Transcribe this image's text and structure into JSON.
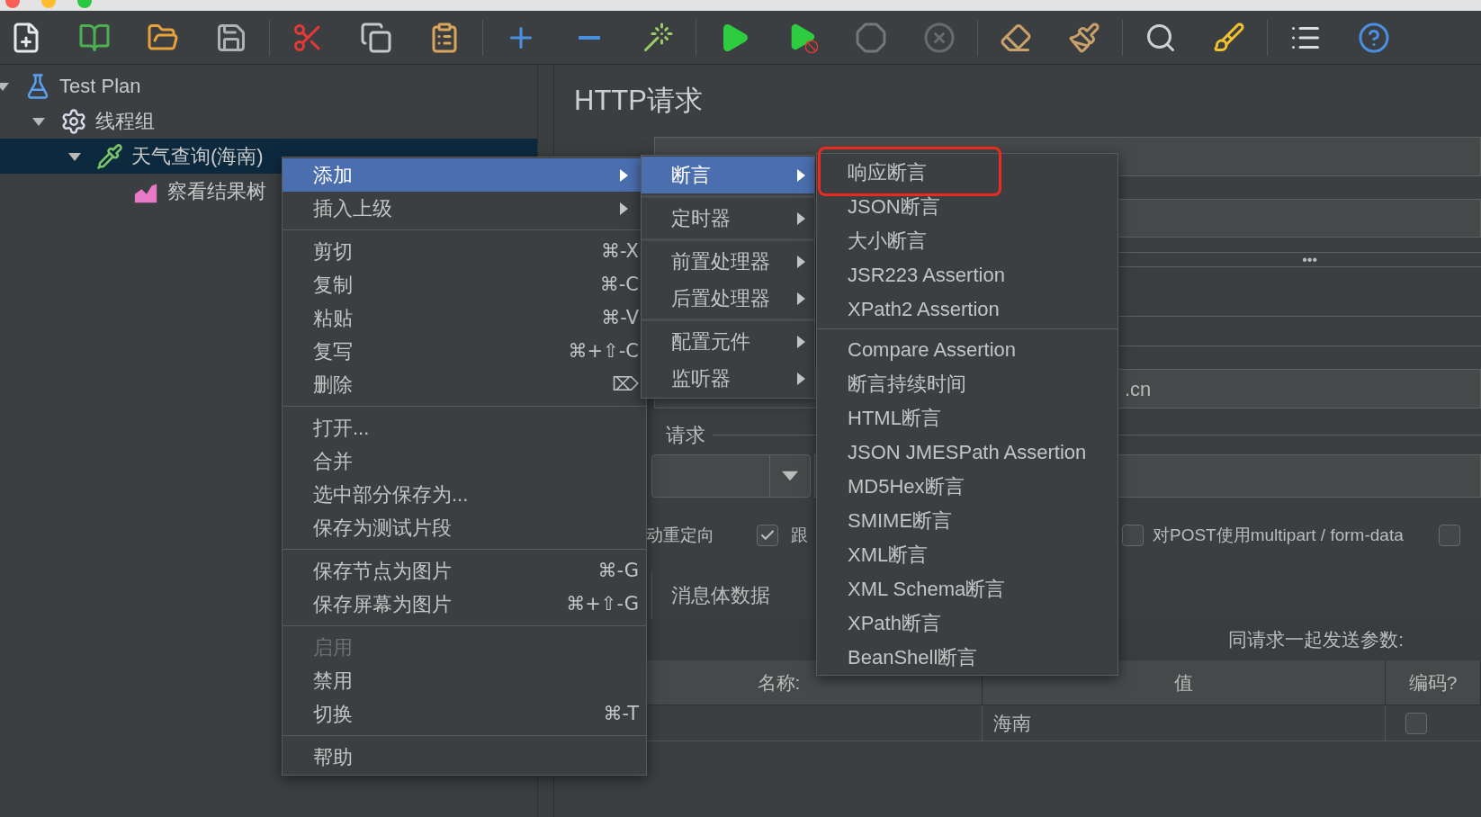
{
  "tree": [
    {
      "label": "Test Plan",
      "kind": "plan",
      "expanded": true,
      "selected": false,
      "children": [
        {
          "label": "线程组",
          "kind": "thread_group",
          "expanded": true,
          "selected": false,
          "children": [
            {
              "label": "天气查询(海南)",
              "kind": "sampler",
              "expanded": true,
              "selected": true,
              "children": [
                {
                  "label": "察看结果树",
                  "kind": "listener",
                  "selected": false
                }
              ]
            }
          ]
        }
      ]
    }
  ],
  "editor": {
    "title": "HTTP请求",
    "more_button": "•••",
    "server_value": ".cn",
    "group_label": "请求",
    "redirect_label": "动重定向",
    "checkboxes": [
      {
        "label": "跟",
        "checked": true
      },
      {
        "label": "对POST使用multipart / form-data",
        "checked": false
      },
      {
        "checked": false
      }
    ],
    "tabs": [
      {
        "label": "消息体数据",
        "selected": false
      }
    ],
    "params_caption": "同请求一起发送参数:",
    "columns": [
      "名称:",
      "值",
      "编码?"
    ],
    "rows": [
      {
        "value": "海南",
        "encode": false
      }
    ]
  },
  "context_menu": {
    "sections": [
      {
        "items": [
          {
            "label": "添加",
            "submenu": true,
            "selected": true,
            "disabled": false
          },
          {
            "label": "插入上级",
            "submenu": true,
            "selected": false,
            "disabled": false
          }
        ]
      },
      {
        "items": [
          {
            "label": "剪切",
            "shortcut": "⌘-X",
            "submenu": false,
            "selected": false,
            "disabled": false
          },
          {
            "label": "复制",
            "shortcut": "⌘-C",
            "submenu": false,
            "selected": false,
            "disabled": false
          },
          {
            "label": "粘贴",
            "shortcut": "⌘-V",
            "submenu": false,
            "selected": false,
            "disabled": false
          },
          {
            "label": "复写",
            "shortcut": "⌘+⇧-C",
            "submenu": false,
            "selected": false,
            "disabled": false
          },
          {
            "label": "删除",
            "shortcut": "⌦",
            "submenu": false,
            "selected": false,
            "disabled": false
          }
        ]
      },
      {
        "items": [
          {
            "label": "打开...",
            "submenu": false,
            "selected": false,
            "disabled": false
          },
          {
            "label": "合并",
            "submenu": false,
            "selected": false,
            "disabled": false
          },
          {
            "label": "选中部分保存为...",
            "submenu": false,
            "selected": false,
            "disabled": false
          },
          {
            "label": "保存为测试片段",
            "submenu": false,
            "selected": false,
            "disabled": false
          }
        ]
      },
      {
        "items": [
          {
            "label": "保存节点为图片",
            "shortcut": "⌘-G",
            "submenu": false,
            "selected": false,
            "disabled": false
          },
          {
            "label": "保存屏幕为图片",
            "shortcut": "⌘+⇧-G",
            "submenu": false,
            "selected": false,
            "disabled": false
          }
        ]
      },
      {
        "items": [
          {
            "label": "启用",
            "submenu": false,
            "selected": false,
            "disabled": true
          },
          {
            "label": "禁用",
            "submenu": false,
            "selected": false,
            "disabled": false
          },
          {
            "label": "切换",
            "shortcut": "⌘-T",
            "submenu": false,
            "selected": false,
            "disabled": false
          }
        ]
      },
      {
        "items": [
          {
            "label": "帮助",
            "submenu": false,
            "selected": false,
            "disabled": false
          }
        ]
      }
    ]
  },
  "add_submenu": {
    "sections": [
      {
        "items": [
          {
            "label": "断言",
            "submenu": true,
            "selected": true
          }
        ]
      },
      {
        "items": [
          {
            "label": "定时器",
            "submenu": true,
            "selected": false
          }
        ]
      },
      {
        "items": [
          {
            "label": "前置处理器",
            "submenu": true,
            "selected": false
          },
          {
            "label": "后置处理器",
            "submenu": true,
            "selected": false
          }
        ]
      },
      {
        "items": [
          {
            "label": "配置元件",
            "submenu": true,
            "selected": false
          },
          {
            "label": "监听器",
            "submenu": true,
            "selected": false
          }
        ]
      }
    ]
  },
  "assertion_submenu": {
    "sections": [
      {
        "items": [
          {
            "label": "响应断言",
            "annotated": true,
            "selected": false
          },
          {
            "label": "JSON断言",
            "annotated": false,
            "selected": false
          },
          {
            "label": "大小断言",
            "annotated": false,
            "selected": false
          },
          {
            "label": "JSR223 Assertion",
            "annotated": false,
            "selected": false
          },
          {
            "label": "XPath2 Assertion",
            "annotated": false,
            "selected": false
          }
        ]
      },
      {
        "items": [
          {
            "label": "Compare Assertion",
            "annotated": false,
            "selected": false
          },
          {
            "label": "断言持续时间",
            "annotated": false,
            "selected": false
          },
          {
            "label": "HTML断言",
            "annotated": false,
            "selected": false
          },
          {
            "label": "JSON JMESPath Assertion",
            "annotated": false,
            "selected": false
          },
          {
            "label": "MD5Hex断言",
            "annotated": false,
            "selected": false
          },
          {
            "label": "SMIME断言",
            "annotated": false,
            "selected": false
          },
          {
            "label": "XML断言",
            "annotated": false,
            "selected": false
          },
          {
            "label": "XML Schema断言",
            "annotated": false,
            "selected": false
          },
          {
            "label": "XPath断言",
            "annotated": false,
            "selected": false
          },
          {
            "label": "BeanShell断言",
            "annotated": false,
            "selected": false
          }
        ]
      }
    ]
  }
}
